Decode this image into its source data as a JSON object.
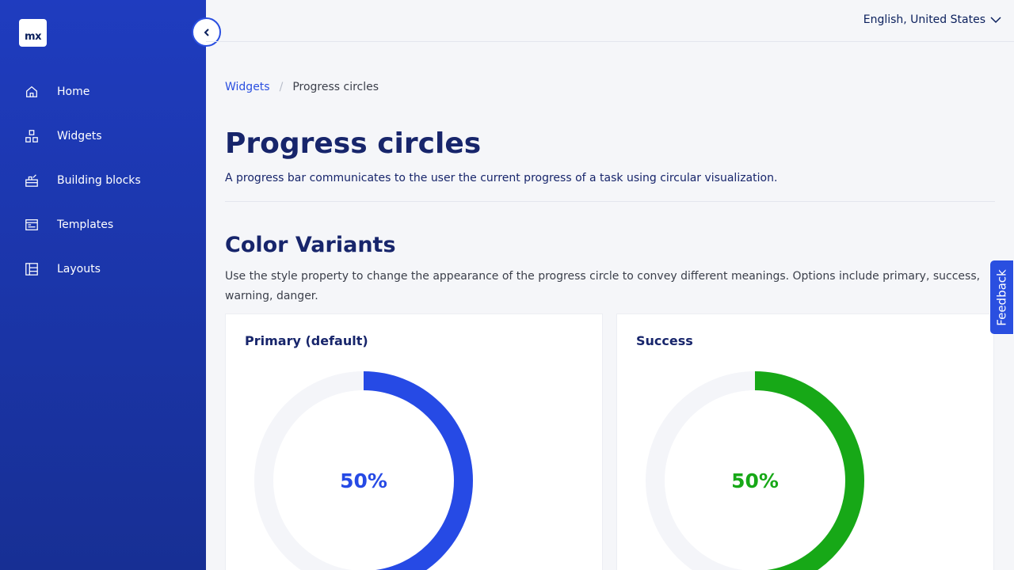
{
  "app": {
    "logo_text": "mx"
  },
  "sidebar": {
    "items": [
      {
        "label": "Home",
        "icon": "home-icon"
      },
      {
        "label": "Widgets",
        "icon": "widgets-icon"
      },
      {
        "label": "Building blocks",
        "icon": "building-blocks-icon"
      },
      {
        "label": "Templates",
        "icon": "templates-icon"
      },
      {
        "label": "Layouts",
        "icon": "layouts-icon"
      }
    ]
  },
  "topbar": {
    "language": "English, United States"
  },
  "breadcrumb": {
    "parent": "Widgets",
    "separator": "/",
    "current": "Progress circles"
  },
  "page": {
    "title": "Progress circles",
    "description": "A progress bar communicates to the user the current progress of a task using circular visualization."
  },
  "section": {
    "title": "Color Variants",
    "description": "Use the style property to change the appearance of the progress circle to convey different meanings. Options include primary, success, warning, danger."
  },
  "cards": [
    {
      "title": "Primary (default)",
      "value": 50,
      "label": "50%",
      "color": "#264ae5"
    },
    {
      "title": "Success",
      "value": 50,
      "label": "50%",
      "color": "#17a817"
    }
  ],
  "feedback": {
    "label": "Feedback"
  },
  "colors": {
    "accent": "#2a4fe0",
    "track": "#f4f5f9",
    "heading": "#17256b"
  }
}
